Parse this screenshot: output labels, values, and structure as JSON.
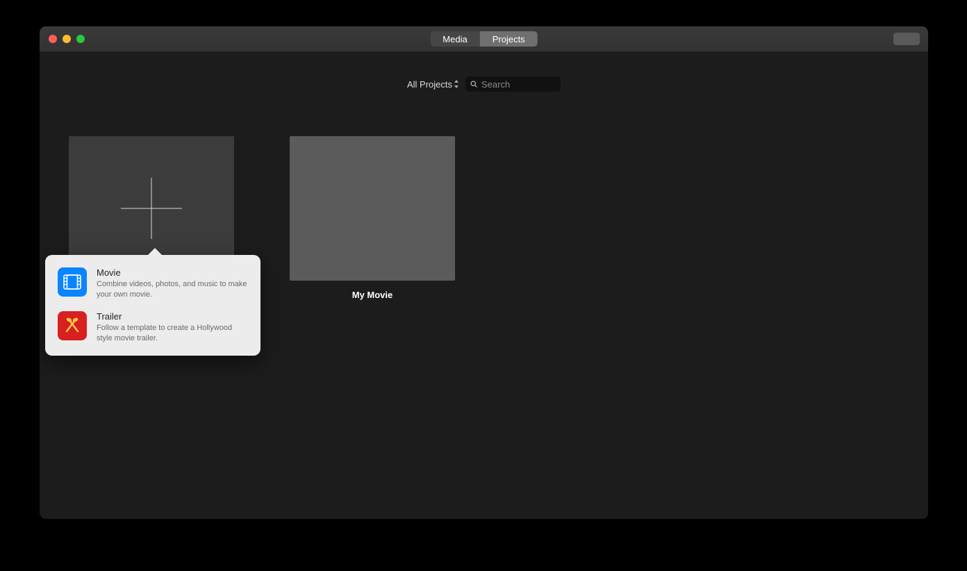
{
  "titlebar": {
    "tabs": {
      "media": "Media",
      "projects": "Projects",
      "active": "projects"
    }
  },
  "filter": {
    "dropdown_label": "All Projects",
    "search_placeholder": "Search"
  },
  "tiles": {
    "project1_label": "My Movie"
  },
  "popover": {
    "movie": {
      "title": "Movie",
      "desc": "Combine videos, photos, and music to make your own movie."
    },
    "trailer": {
      "title": "Trailer",
      "desc": "Follow a template to create a Hollywood style movie trailer."
    }
  }
}
